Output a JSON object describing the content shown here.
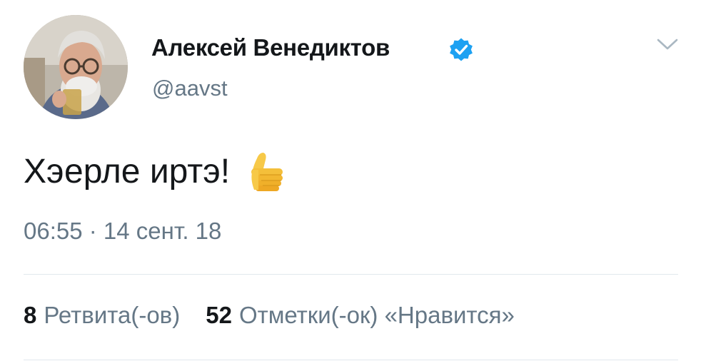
{
  "tweet": {
    "author": {
      "display_name": "Алексей Венедиктов",
      "handle": "@aavst",
      "verified": true,
      "avatar_icon": "avatar-photo"
    },
    "text": "Хэерле иртэ!",
    "emoji": "thumbs-up",
    "timestamp": "06:55 · 14 сент. 18",
    "stats": {
      "retweets_count": "8",
      "retweets_label": "Ретвита(-ов)",
      "likes_count": "52",
      "likes_label": "Отметки(-ок) «Нравится»"
    }
  },
  "colors": {
    "text_primary": "#14171a",
    "text_secondary": "#657786",
    "verified_blue": "#1da1f2",
    "divider": "#e1e8ed"
  }
}
